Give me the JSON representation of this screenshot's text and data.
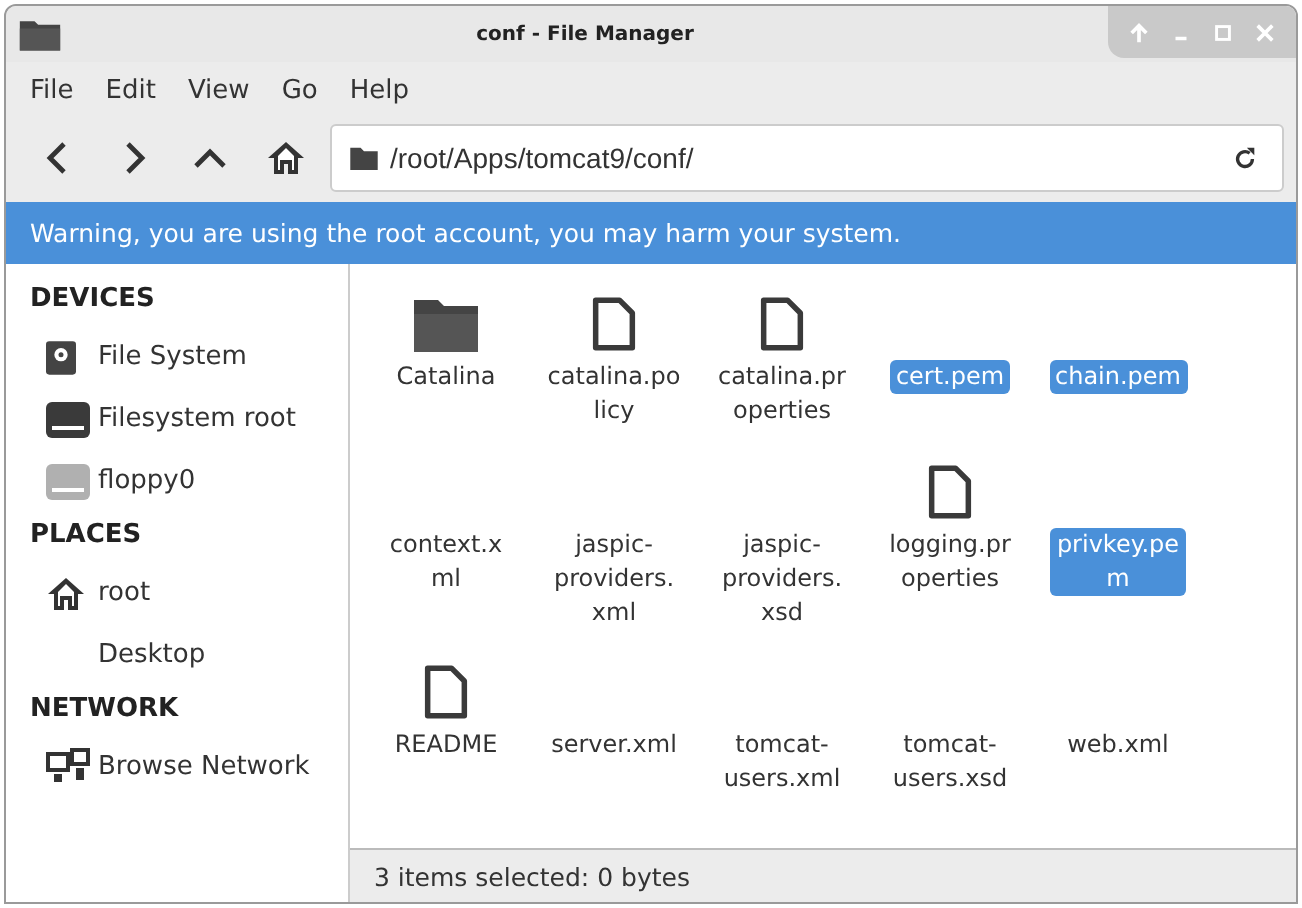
{
  "window": {
    "title": "conf - File Manager"
  },
  "menu": [
    "File",
    "Edit",
    "View",
    "Go",
    "Help"
  ],
  "address": {
    "value": "/root/Apps/tomcat9/conf/"
  },
  "warning": "Warning, you are using the root account, you may harm your system.",
  "sidebar": [
    {
      "heading": "DEVICES",
      "items": [
        {
          "label": "File System",
          "kind": "disk"
        },
        {
          "label": "Filesystem root",
          "kind": "drive"
        },
        {
          "label": "floppy0",
          "kind": "floppy"
        }
      ]
    },
    {
      "heading": "PLACES",
      "items": [
        {
          "label": "root",
          "kind": "home"
        },
        {
          "label": "Desktop",
          "kind": "place"
        }
      ]
    },
    {
      "heading": "NETWORK",
      "items": [
        {
          "label": "Browse Network",
          "kind": "network"
        }
      ]
    }
  ],
  "files": [
    [
      {
        "lines": [
          "Catalina"
        ],
        "kind": "folder",
        "selected": false
      },
      {
        "lines": [
          "catalina.po",
          "licy"
        ],
        "kind": "file",
        "selected": false
      },
      {
        "lines": [
          "catalina.pr",
          "operties"
        ],
        "kind": "file",
        "selected": false
      },
      {
        "lines": [
          "cert.pem"
        ],
        "kind": "plain",
        "selected": true
      },
      {
        "lines": [
          "chain.pem"
        ],
        "kind": "plain",
        "selected": true
      }
    ],
    [
      {
        "lines": [
          "context.x",
          "ml"
        ],
        "kind": "plain",
        "selected": false
      },
      {
        "lines": [
          "jaspic-",
          "providers.",
          "xml"
        ],
        "kind": "plain",
        "selected": false
      },
      {
        "lines": [
          "jaspic-",
          "providers.",
          "xsd"
        ],
        "kind": "plain",
        "selected": false
      },
      {
        "lines": [
          "logging.pr",
          "operties"
        ],
        "kind": "file",
        "selected": false
      },
      {
        "lines": [
          "privkey.pe",
          "m"
        ],
        "kind": "plain",
        "selected": true
      }
    ],
    [
      {
        "lines": [
          "README"
        ],
        "kind": "file",
        "selected": false
      },
      {
        "lines": [
          "server.xml"
        ],
        "kind": "plain",
        "selected": false
      },
      {
        "lines": [
          "tomcat-",
          "users.xml"
        ],
        "kind": "plain",
        "selected": false
      },
      {
        "lines": [
          "tomcat-",
          "users.xsd"
        ],
        "kind": "plain",
        "selected": false
      },
      {
        "lines": [
          "web.xml"
        ],
        "kind": "plain",
        "selected": false
      }
    ]
  ],
  "status": "3 items selected: 0 bytes"
}
